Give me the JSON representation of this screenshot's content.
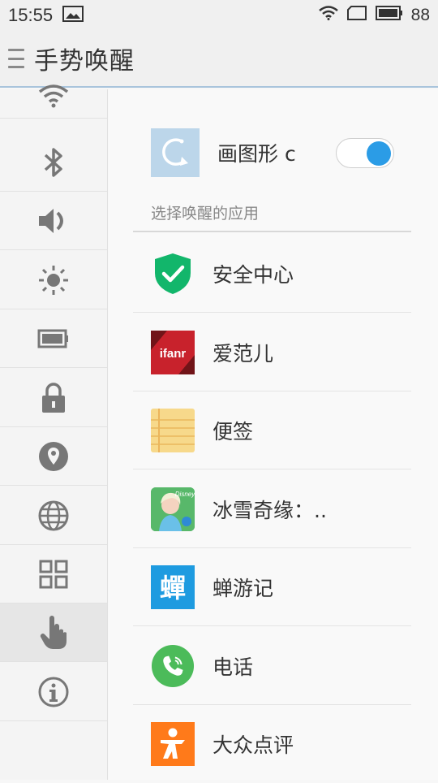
{
  "status_bar": {
    "time": "15:55",
    "battery": "88",
    "icons": [
      "image-icon",
      "wifi-icon",
      "sim-icon",
      "battery-icon"
    ]
  },
  "header": {
    "title": "手势唤醒",
    "menu_icon": "menu-icon"
  },
  "sidebar": {
    "items": [
      {
        "icon": "wifi-icon"
      },
      {
        "icon": "bluetooth-icon"
      },
      {
        "icon": "volume-icon"
      },
      {
        "icon": "brightness-icon"
      },
      {
        "icon": "battery-icon"
      },
      {
        "icon": "lock-icon"
      },
      {
        "icon": "location-icon"
      },
      {
        "icon": "globe-icon"
      },
      {
        "icon": "apps-grid-icon"
      },
      {
        "icon": "gesture-hand-icon",
        "active": true
      },
      {
        "icon": "info-icon"
      }
    ]
  },
  "gesture": {
    "label": "画图形 c",
    "enabled": true
  },
  "section": {
    "title": "选择唤醒的应用"
  },
  "apps": [
    {
      "name": "安全中心",
      "icon": "security-shield-icon"
    },
    {
      "name": "爱范儿",
      "icon": "ifanr-icon",
      "icon_text": "ifanr"
    },
    {
      "name": "便签",
      "icon": "notes-icon"
    },
    {
      "name": "冰雪奇缘：..",
      "icon": "frozen-game-icon",
      "icon_text": "Disney"
    },
    {
      "name": "蝉游记",
      "icon": "chanyouji-icon",
      "icon_text": "蟬"
    },
    {
      "name": "电话",
      "icon": "phone-icon"
    },
    {
      "name": "大众点评",
      "icon": "dianping-icon"
    }
  ],
  "colors": {
    "accent": "#2b9ce6",
    "header_underline": "#a9c4dc",
    "security_green": "#12b66b",
    "ifanr_red": "#c8222c",
    "notes_yellow": "#f7d98b",
    "chanyouji_blue": "#1e9be0",
    "phone_green": "#4cbb5a",
    "dianping_orange": "#ff7a1a"
  }
}
